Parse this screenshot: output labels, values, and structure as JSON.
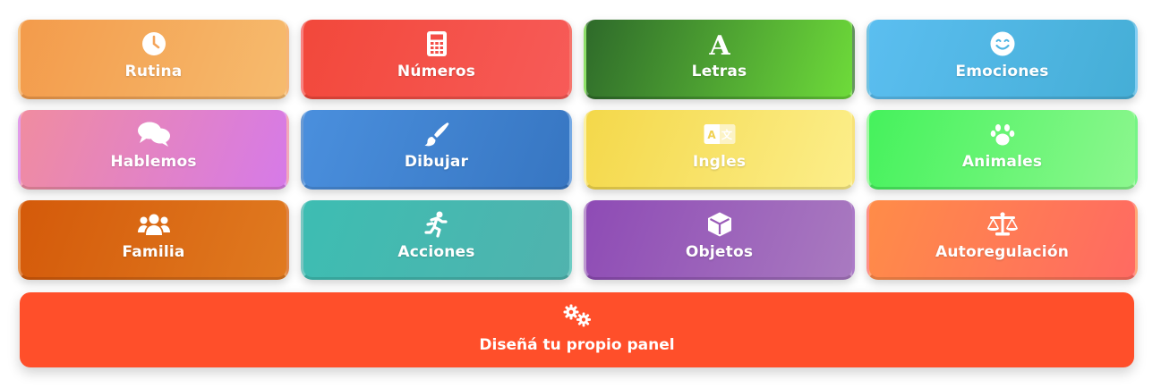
{
  "panels": [
    {
      "label": "Rutina",
      "icon": "clock-icon",
      "gradient": [
        "#F39B4B",
        "#F6BB6E"
      ]
    },
    {
      "label": "Números",
      "icon": "calculator-icon",
      "gradient": [
        "#F2483B",
        "#F75B58"
      ]
    },
    {
      "label": "Letras",
      "icon": "letter-a-icon",
      "gradient": [
        "#2E6A2A",
        "#6EDB3A"
      ]
    },
    {
      "label": "Emociones",
      "icon": "smile-icon",
      "gradient": [
        "#5BBEF0",
        "#45AED6"
      ]
    },
    {
      "label": "Hablemos",
      "icon": "chat-bubbles-icon",
      "gradient": [
        "#F08CA0",
        "#D67AE8"
      ]
    },
    {
      "label": "Dibujar",
      "icon": "paintbrush-icon",
      "gradient": [
        "#4A8FDD",
        "#3776C2"
      ]
    },
    {
      "label": "Ingles",
      "icon": "translate-icon",
      "gradient": [
        "#F4D84A",
        "#FCEE8A"
      ]
    },
    {
      "label": "Animales",
      "icon": "paw-icon",
      "gradient": [
        "#45F25C",
        "#8CF78E"
      ]
    },
    {
      "label": "Familia",
      "icon": "users-icon",
      "gradient": [
        "#D45A0A",
        "#E07A20"
      ]
    },
    {
      "label": "Acciones",
      "icon": "running-icon",
      "gradient": [
        "#3DBDB2",
        "#50B3AE"
      ]
    },
    {
      "label": "Objetos",
      "icon": "cube-icon",
      "gradient": [
        "#8E4BB5",
        "#A97AC0"
      ]
    },
    {
      "label": "Autoregulación",
      "icon": "scale-icon",
      "gradient": [
        "#FF8C48",
        "#FF6A62"
      ]
    }
  ],
  "design_panel": {
    "label": "Diseñá tu propio panel",
    "icon": "gears-icon",
    "color": "#FF4F2A"
  }
}
